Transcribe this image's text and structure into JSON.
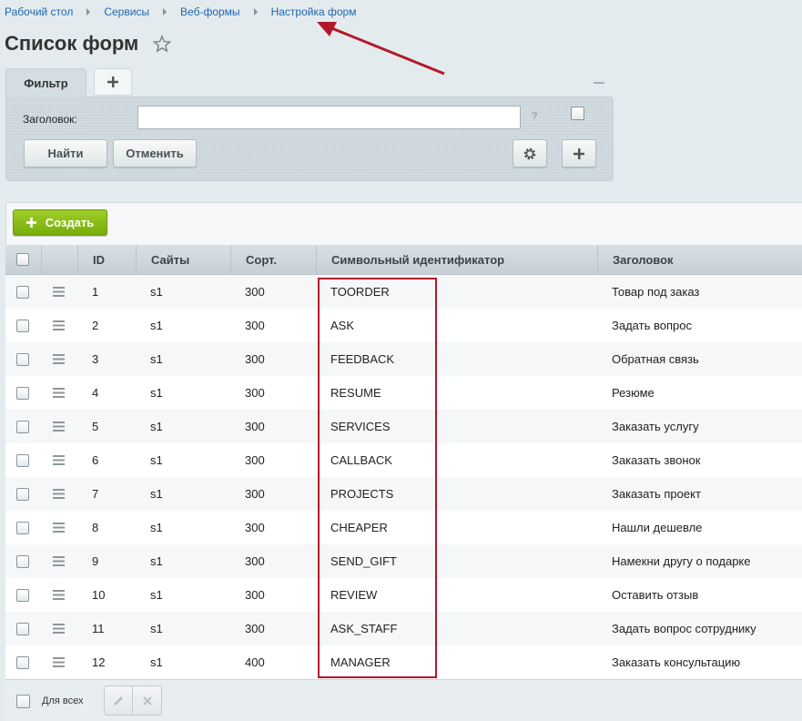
{
  "breadcrumb": [
    "Рабочий стол",
    "Сервисы",
    "Веб-формы",
    "Настройка форм"
  ],
  "page_title": "Список форм",
  "filter": {
    "tab_label": "Фильтр",
    "title_label": "Заголовок:",
    "title_value": "",
    "help": "?",
    "find_button": "Найти",
    "cancel_button": "Отменить"
  },
  "list": {
    "create_button": "Создать",
    "columns": [
      "ID",
      "Сайты",
      "Сорт.",
      "Символьный идентификатор",
      "Заголовок"
    ],
    "rows": [
      {
        "id": "1",
        "site": "s1",
        "sort": "300",
        "sid": "TOORDER",
        "title": "Товар под заказ"
      },
      {
        "id": "2",
        "site": "s1",
        "sort": "300",
        "sid": "ASK",
        "title": "Задать вопрос"
      },
      {
        "id": "3",
        "site": "s1",
        "sort": "300",
        "sid": "FEEDBACK",
        "title": "Обратная связь"
      },
      {
        "id": "4",
        "site": "s1",
        "sort": "300",
        "sid": "RESUME",
        "title": "Резюме"
      },
      {
        "id": "5",
        "site": "s1",
        "sort": "300",
        "sid": "SERVICES",
        "title": "Заказать услугу"
      },
      {
        "id": "6",
        "site": "s1",
        "sort": "300",
        "sid": "CALLBACK",
        "title": "Заказать звонок"
      },
      {
        "id": "7",
        "site": "s1",
        "sort": "300",
        "sid": "PROJECTS",
        "title": "Заказать проект"
      },
      {
        "id": "8",
        "site": "s1",
        "sort": "300",
        "sid": "CHEAPER",
        "title": "Нашли дешевле"
      },
      {
        "id": "9",
        "site": "s1",
        "sort": "300",
        "sid": "SEND_GIFT",
        "title": "Намекни другу о подарке"
      },
      {
        "id": "10",
        "site": "s1",
        "sort": "300",
        "sid": "REVIEW",
        "title": "Оставить отзыв"
      },
      {
        "id": "11",
        "site": "s1",
        "sort": "300",
        "sid": "ASK_STAFF",
        "title": "Задать вопрос сотруднику"
      },
      {
        "id": "12",
        "site": "s1",
        "sort": "400",
        "sid": "MANAGER",
        "title": "Заказать консультацию"
      }
    ],
    "for_all_label": "Для всех"
  },
  "colors": {
    "link": "#2067b0",
    "site_link": "#90489a",
    "create_green": "#86b817",
    "annotation_red": "#b3182a"
  },
  "icons": [
    "star-icon",
    "plus-icon",
    "gear-icon",
    "row-menu-icon",
    "pencil-icon",
    "close-icon",
    "arrow-annotation"
  ]
}
